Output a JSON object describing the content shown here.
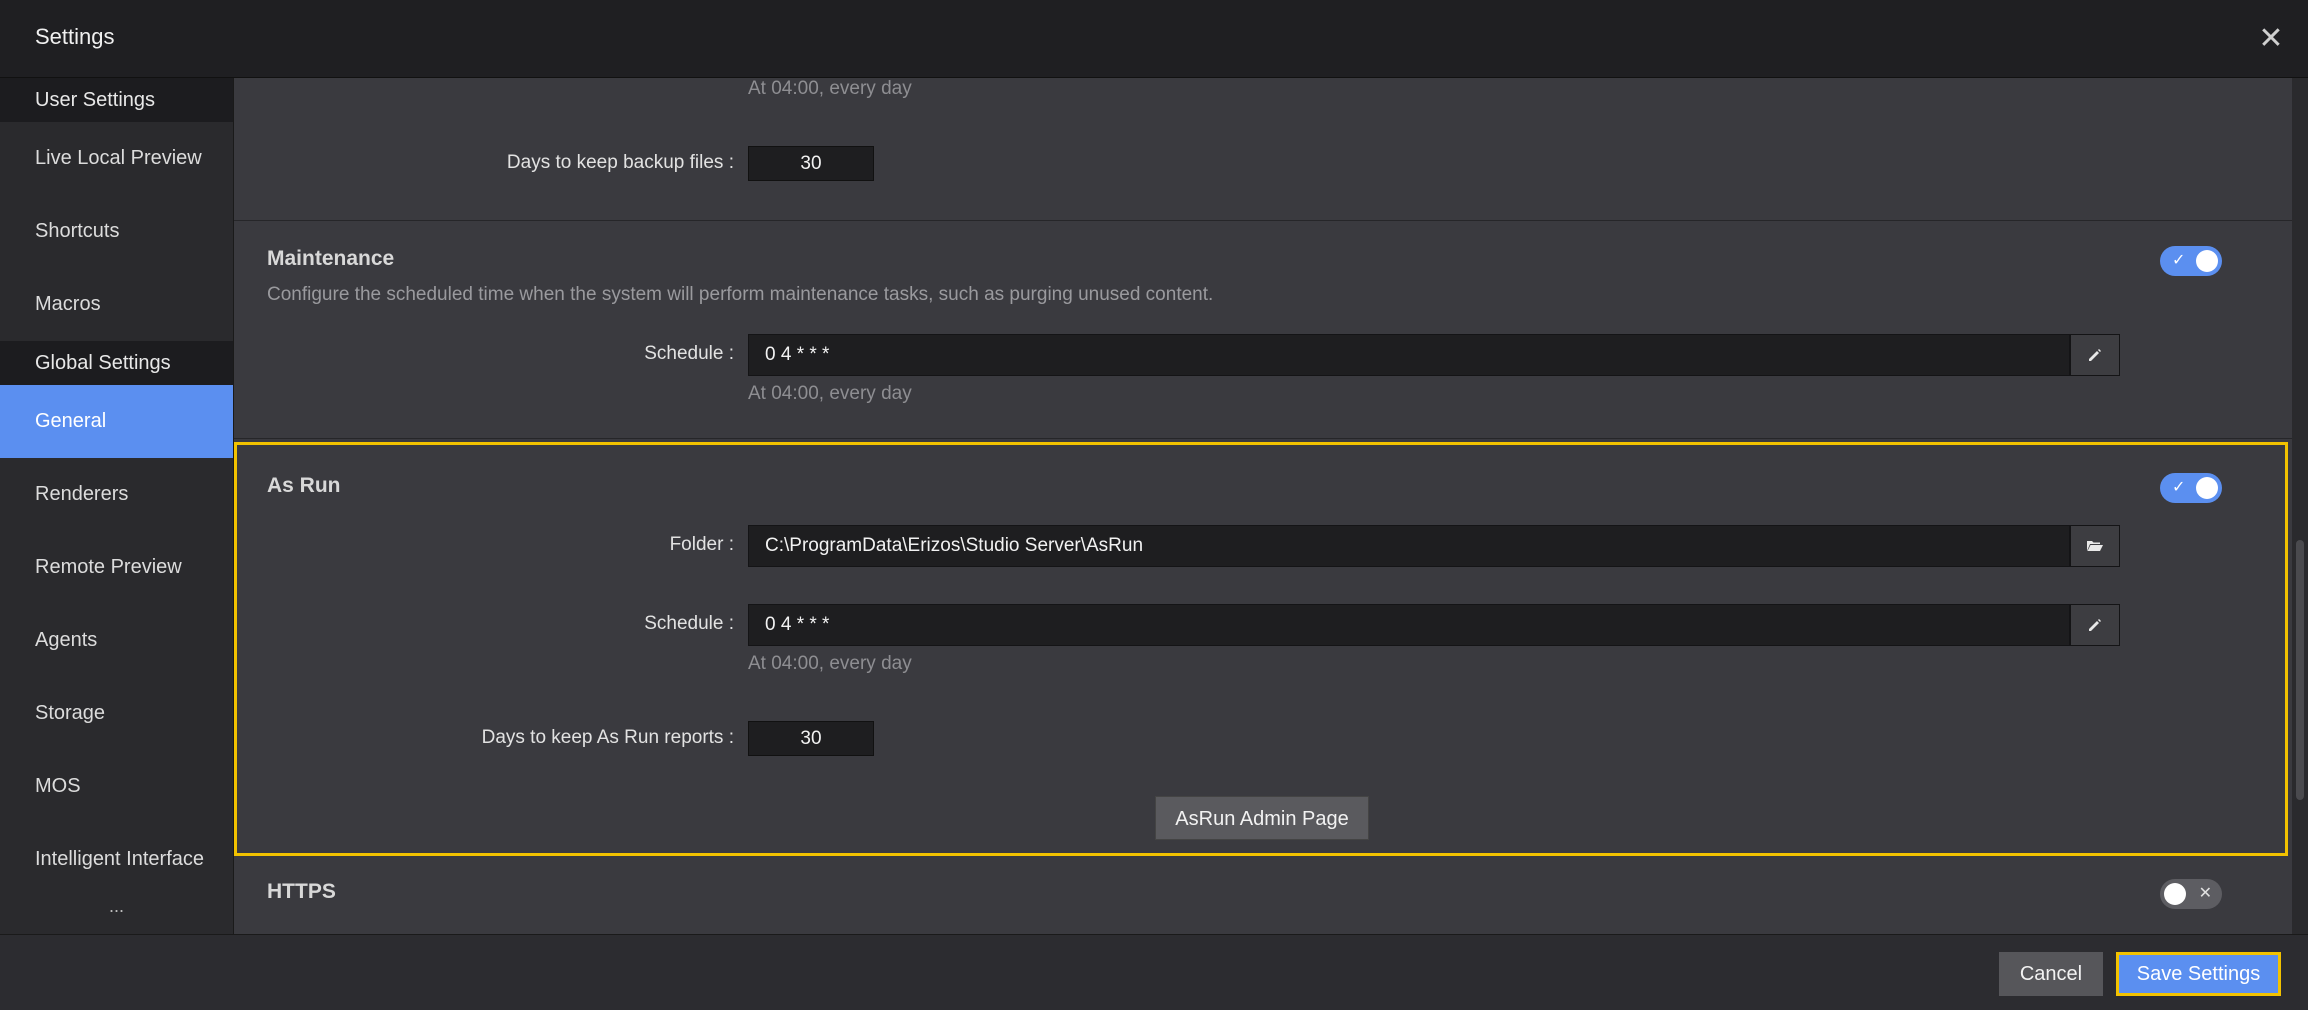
{
  "window": {
    "title": "Settings",
    "close_glyph": "✕"
  },
  "sidebar": {
    "user_header": "User Settings",
    "user_items": [
      {
        "label": "Live Local Preview"
      },
      {
        "label": "Shortcuts"
      },
      {
        "label": "Macros"
      }
    ],
    "global_header": "Global Settings",
    "global_items": [
      {
        "label": "General",
        "active": true
      },
      {
        "label": "Renderers"
      },
      {
        "label": "Remote Preview"
      },
      {
        "label": "Agents"
      },
      {
        "label": "Storage"
      },
      {
        "label": "MOS"
      },
      {
        "label": "Intelligent Interface"
      }
    ],
    "more": "..."
  },
  "backup": {
    "schedule_hint": "At 04:00, every day",
    "days_label": "Days to keep backup files",
    "days_value": "30"
  },
  "maintenance": {
    "title": "Maintenance",
    "enabled": true,
    "description": "Configure the scheduled time when the system will perform maintenance tasks, such as purging unused content.",
    "schedule_label": "Schedule",
    "schedule_value": "0 4 * * *",
    "schedule_hint": "At 04:00, every day"
  },
  "asrun": {
    "title": "As Run",
    "enabled": true,
    "folder_label": "Folder",
    "folder_value": "C:\\ProgramData\\Erizos\\Studio Server\\AsRun",
    "schedule_label": "Schedule",
    "schedule_value": "0 4 * * *",
    "schedule_hint": "At 04:00, every day",
    "days_label": "Days to keep As Run reports",
    "days_value": "30",
    "admin_button": "AsRun Admin Page"
  },
  "https": {
    "title": "HTTPS",
    "enabled": false
  },
  "footer": {
    "cancel": "Cancel",
    "save": "Save Settings"
  },
  "icons": {
    "close": "close-icon",
    "edit": "pencil-icon",
    "folder": "folder-open-icon",
    "toggle_on": "check-icon",
    "toggle_off": "x-icon"
  },
  "colors": {
    "accent": "#5b8ff0",
    "focus": "#f2c200",
    "background": "#3a3a3f",
    "sidebar": "#2a2a2d"
  }
}
